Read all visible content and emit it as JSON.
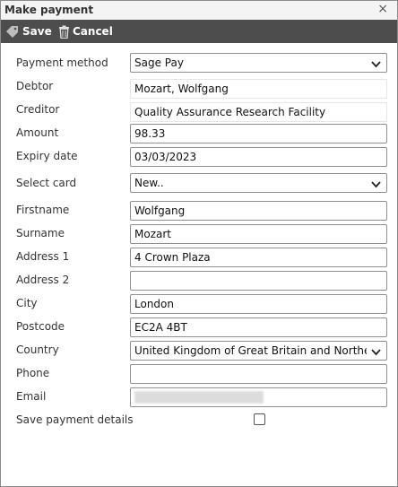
{
  "dialog": {
    "title": "Make payment",
    "close_glyph": "×"
  },
  "toolbar": {
    "save_label": "Save",
    "save_icon": "tag-icon",
    "cancel_label": "Cancel",
    "cancel_icon": "trash-icon"
  },
  "form": {
    "payment_method": {
      "label": "Payment method",
      "value": "Sage Pay"
    },
    "debtor": {
      "label": "Debtor",
      "value": "Mozart, Wolfgang"
    },
    "creditor": {
      "label": "Creditor",
      "value": "Quality Assurance Research Facility"
    },
    "amount": {
      "label": "Amount",
      "value": "98.33"
    },
    "expiry_date": {
      "label": "Expiry date",
      "value": "03/03/2023"
    },
    "select_card": {
      "label": "Select card",
      "value": "New.."
    },
    "firstname": {
      "label": "Firstname",
      "value": "Wolfgang"
    },
    "surname": {
      "label": "Surname",
      "value": "Mozart"
    },
    "address1": {
      "label": "Address 1",
      "value": "4 Crown Plaza"
    },
    "address2": {
      "label": "Address 2",
      "value": ""
    },
    "city": {
      "label": "City",
      "value": "London"
    },
    "postcode": {
      "label": "Postcode",
      "value": "EC2A 4BT"
    },
    "country": {
      "label": "Country",
      "value": "United Kingdom of Great Britain and Northern I"
    },
    "phone": {
      "label": "Phone",
      "value": ""
    },
    "email": {
      "label": "Email",
      "value": ""
    },
    "save_payment_details": {
      "label": "Save payment details",
      "checked": false
    }
  },
  "colors": {
    "toolbar_bg": "#4d4d4d",
    "border": "#8f8f8f"
  }
}
